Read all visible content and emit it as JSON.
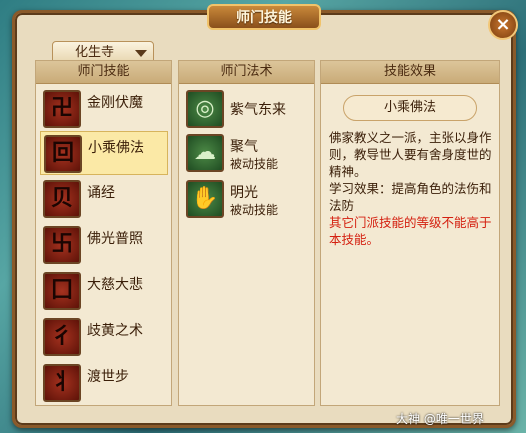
{
  "window": {
    "title": "师门技能",
    "close_icon": "×"
  },
  "school_dropdown": {
    "selected": "化生寺"
  },
  "columns": {
    "school_skills": "师门技能",
    "school_spells": "师门法术",
    "skill_effect": "技能效果"
  },
  "school_skills": [
    {
      "name": "金刚伏魔",
      "icon": "卍"
    },
    {
      "name": "小乘佛法",
      "icon": "回",
      "selected": true
    },
    {
      "name": "诵经",
      "icon": "贝"
    },
    {
      "name": "佛光普照",
      "icon": "卐"
    },
    {
      "name": "大慈大悲",
      "icon": "囗"
    },
    {
      "name": "歧黄之术",
      "icon": "彳"
    },
    {
      "name": "渡世步",
      "icon": "丬"
    }
  ],
  "school_spells": [
    {
      "name": "紫气东来",
      "sub": "",
      "icon": "◎"
    },
    {
      "name": "聚气",
      "sub": "被动技能",
      "icon": "☁"
    },
    {
      "name": "明光",
      "sub": "被动技能",
      "icon": "✋"
    }
  ],
  "effect": {
    "title": "小乘佛法",
    "desc": "佛家教义之一派，主张以身作则，教导世人要有舍身度世的精神。",
    "learn": "学习效果：提高角色的法伤和法防",
    "note": "其它门派技能的等级不能高于本技能。"
  },
  "watermark": "大神 @唯一世界"
}
